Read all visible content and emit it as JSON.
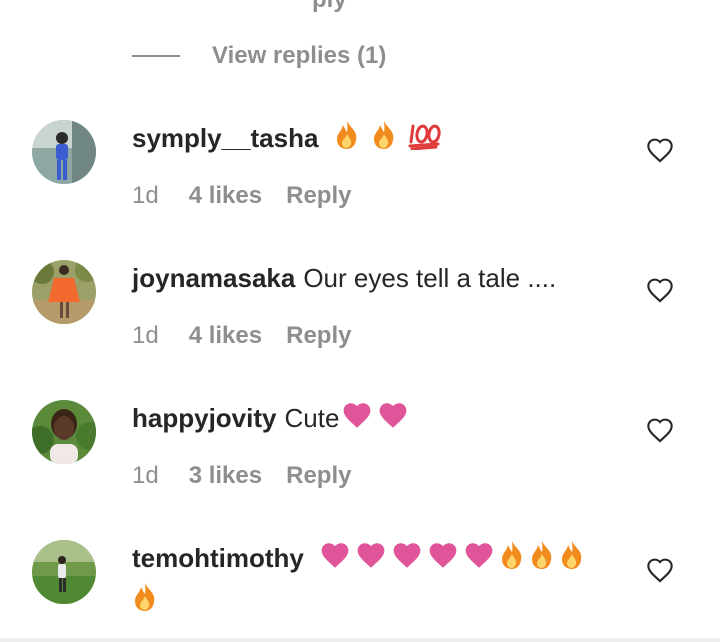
{
  "partial_text": "ply",
  "view_replies_label": "View replies (1)",
  "comments": [
    {
      "username": "symply__tasha",
      "text": "",
      "emojis": [
        "fire",
        "fire",
        "hundred"
      ],
      "time": "1d",
      "likes": "4 likes",
      "reply": "Reply"
    },
    {
      "username": "joynamasaka",
      "text": "Our eyes tell a tale ....",
      "emojis": [],
      "time": "1d",
      "likes": "4 likes",
      "reply": "Reply"
    },
    {
      "username": "happyjovity",
      "text": "Cute",
      "emojis": [
        "heart",
        "heart"
      ],
      "time": "1d",
      "likes": "3 likes",
      "reply": "Reply"
    },
    {
      "username": "temohtimothy",
      "text": "",
      "emojis": [
        "heart",
        "heart",
        "heart",
        "heart",
        "heart",
        "fire",
        "fire",
        "fire",
        "fire"
      ],
      "time": "",
      "likes": "",
      "reply": ""
    }
  ],
  "colors": {
    "text": "#262626",
    "muted": "#8e8e8e",
    "emoji_heart": "#e0559a",
    "emoji_fire": "#f28b1d"
  }
}
